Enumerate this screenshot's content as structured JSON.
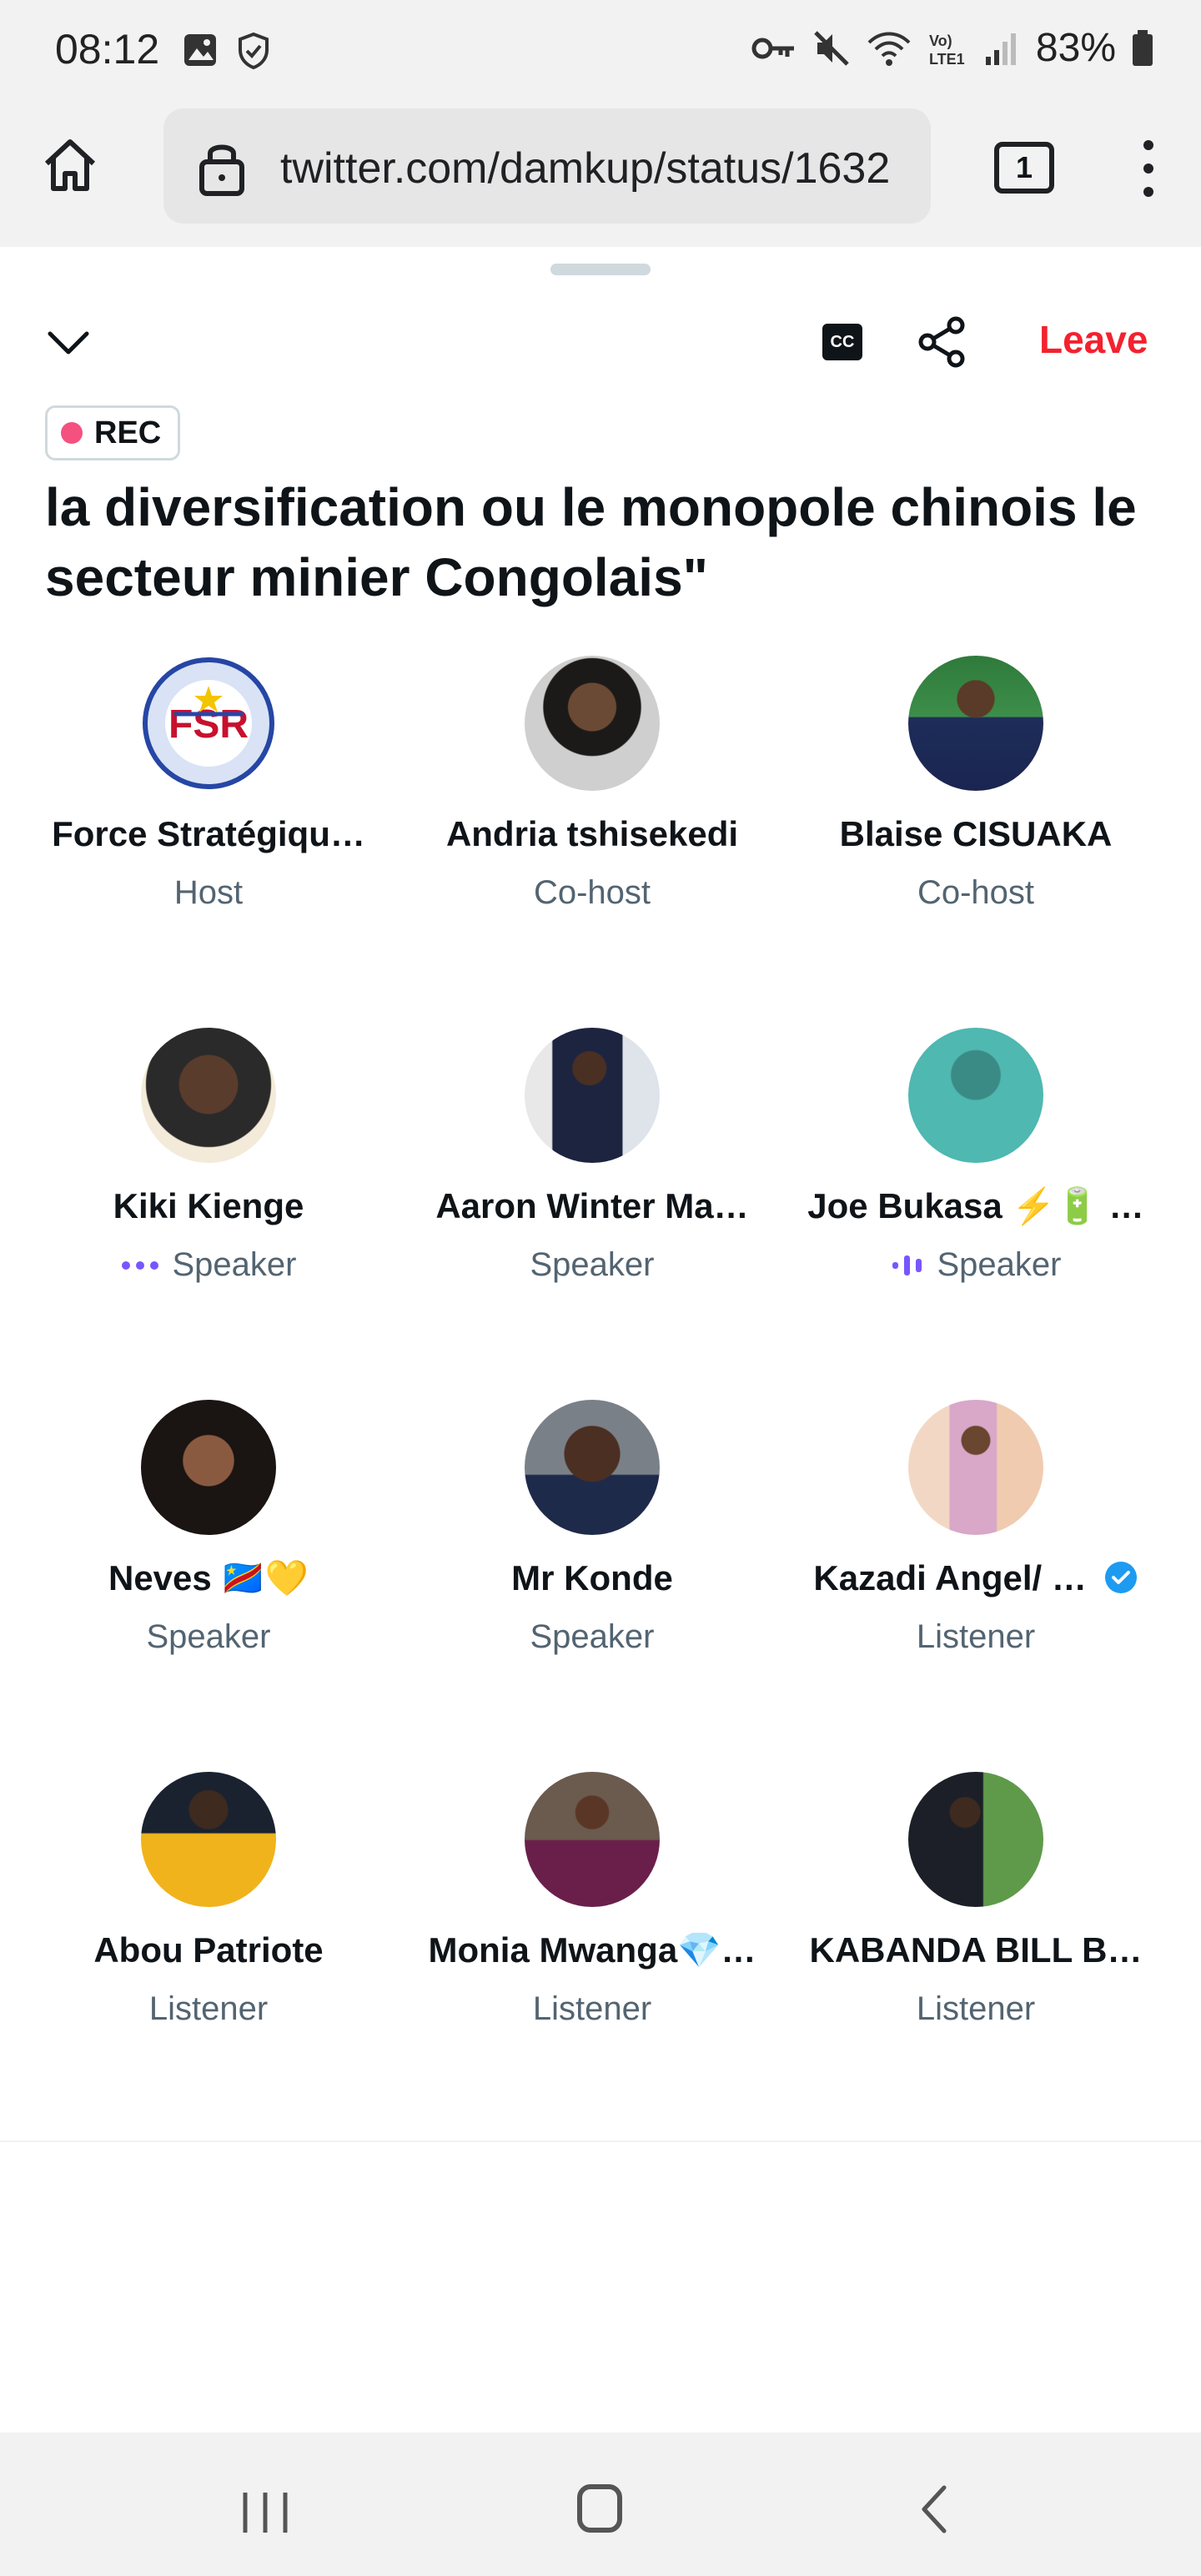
{
  "status": {
    "time": "08:12",
    "battery": "83%",
    "network": "LTE1"
  },
  "browser": {
    "url": "twitter.com/damkup/status/1632",
    "tab_count": "1"
  },
  "space": {
    "cc_label": "CC",
    "leave_label": "Leave",
    "rec_label": "REC",
    "title": "la diversification ou le monopole chinois le secteur minier Congolais\"",
    "accent_color": "#f4212e",
    "participants": [
      {
        "name": "Force Stratégiqu…",
        "role": "Host",
        "avatar": "fsr-logo"
      },
      {
        "name": "Andria tshisekedi",
        "role": "Co-host",
        "avatar": "photo"
      },
      {
        "name": "Blaise CISUAKA",
        "role": "Co-host",
        "avatar": "photo"
      },
      {
        "name": "Kiki Kienge",
        "role": "Speaker",
        "avatar": "photo",
        "indicator": "dots"
      },
      {
        "name": "Aaron Winter Ma…",
        "role": "Speaker",
        "avatar": "photo"
      },
      {
        "name": "Joe Bukasa ⚡🔋 …",
        "role": "Speaker",
        "avatar": "photo",
        "indicator": "bars"
      },
      {
        "name": "Neves 🇨🇩💛",
        "role": "Speaker",
        "avatar": "photo"
      },
      {
        "name": "Mr Konde",
        "role": "Speaker",
        "avatar": "photo"
      },
      {
        "name": "Kazadi Angel/ …",
        "role": "Listener",
        "avatar": "photo",
        "verified": true
      },
      {
        "name": "Abou Patriote",
        "role": "Listener",
        "avatar": "photo"
      },
      {
        "name": "Monia Mwanga💎…",
        "role": "Listener",
        "avatar": "photo"
      },
      {
        "name": "KABANDA BILL B…",
        "role": "Listener",
        "avatar": "photo"
      }
    ]
  }
}
